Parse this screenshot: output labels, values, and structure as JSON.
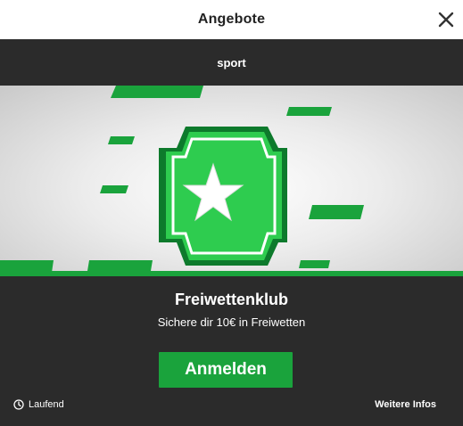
{
  "header": {
    "title": "Angebote"
  },
  "tabs": {
    "active_label": "sport"
  },
  "promo": {
    "title": "Freiwettenklub",
    "subtitle": "Sichere dir 10€ in Freiwetten",
    "cta_label": "Anmelden",
    "status_label": "Laufend",
    "more_info_label": "Weitere Infos"
  },
  "icons": {
    "close": "close-icon",
    "clock": "clock-icon",
    "ticket": "ticket-star-icon"
  },
  "colors": {
    "accent": "#1aa33c",
    "dark_bg": "#2b2b2b",
    "header_bg": "#ffffff"
  }
}
